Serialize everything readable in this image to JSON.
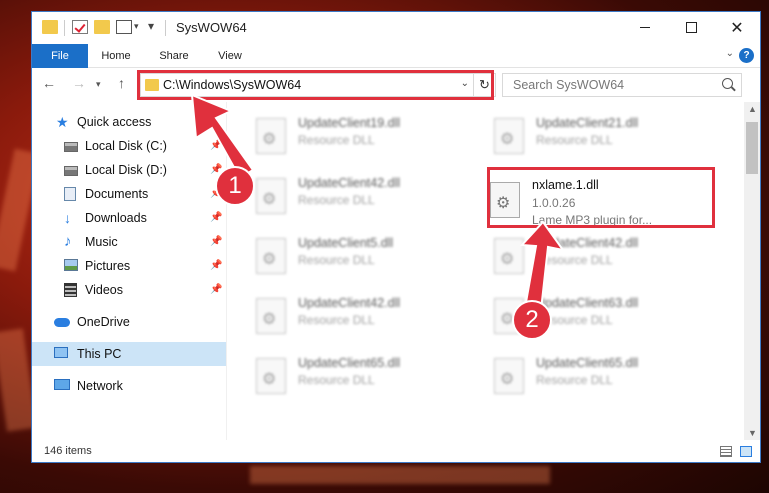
{
  "window": {
    "title": "SysWOW64"
  },
  "ribbon": {
    "tabs": [
      "File",
      "Home",
      "Share",
      "View"
    ],
    "help": "?"
  },
  "address": {
    "path": "C:\\Windows\\SysWOW64"
  },
  "search": {
    "placeholder": "Search SysWOW64"
  },
  "sidebar": {
    "items": [
      {
        "label": "Quick access",
        "icon": "star-icon"
      },
      {
        "label": "Local Disk (C:)",
        "icon": "drive-icon",
        "pinned": true
      },
      {
        "label": "Local Disk (D:)",
        "icon": "drive-icon",
        "pinned": true
      },
      {
        "label": "Documents",
        "icon": "document-icon",
        "pinned": true
      },
      {
        "label": "Downloads",
        "icon": "download-icon",
        "pinned": true
      },
      {
        "label": "Music",
        "icon": "music-icon",
        "pinned": true
      },
      {
        "label": "Pictures",
        "icon": "pictures-icon",
        "pinned": true
      },
      {
        "label": "Videos",
        "icon": "video-icon",
        "pinned": true
      },
      {
        "label": "OneDrive",
        "icon": "cloud-icon"
      },
      {
        "label": "This PC",
        "icon": "computer-icon",
        "selected": true
      },
      {
        "label": "Network",
        "icon": "network-icon"
      }
    ]
  },
  "files": [
    {
      "name": "UpdateClient19.dll",
      "desc": "Resource DLL"
    },
    {
      "name": "UpdateClient21.dll",
      "desc": "Resource DLL"
    },
    {
      "name": "UpdateClient42.dll",
      "desc": "Resource DLL"
    },
    {
      "name": "nxlame.1.dll",
      "version": "1.0.0.26",
      "desc": "Lame MP3 plugin for...",
      "highlighted": true
    },
    {
      "name": "UpdateClient5.dll",
      "desc": "Resource DLL"
    },
    {
      "name": "UpdateClient42.dll",
      "desc": "Resource DLL"
    },
    {
      "name": "UpdateClient42.dll",
      "desc": "Resource DLL"
    },
    {
      "name": "UpdateClient63.dll",
      "desc": "Resource DLL"
    },
    {
      "name": "UpdateClient65.dll",
      "desc": "Resource DLL"
    },
    {
      "name": "UpdateClient65.dll",
      "desc": "Resource DLL"
    }
  ],
  "status": {
    "item_count": "146 items"
  },
  "callouts": [
    "1",
    "2"
  ],
  "colors": {
    "accent": "#1b6fc8",
    "highlight": "#e0303d",
    "selection": "#cce4f7"
  }
}
